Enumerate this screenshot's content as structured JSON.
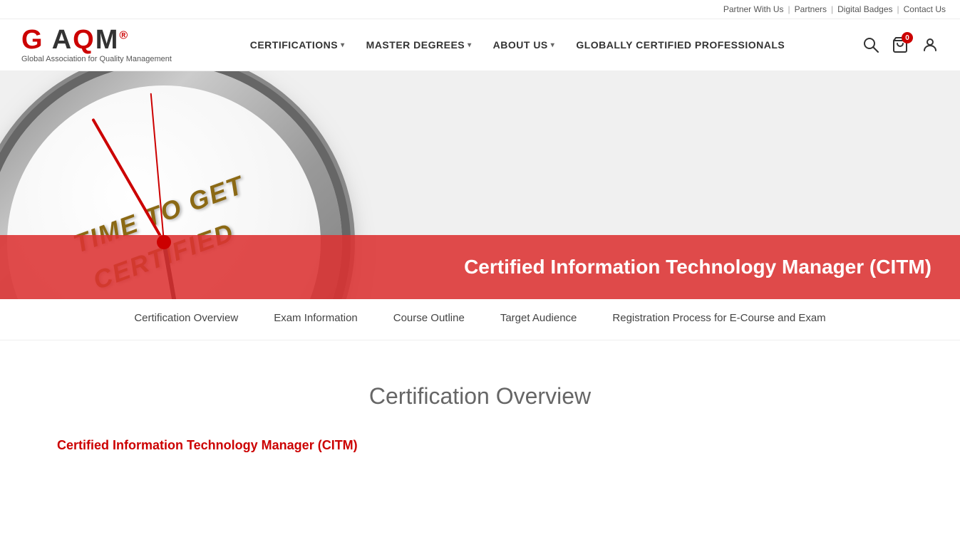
{
  "topbar": {
    "links": [
      {
        "label": "Partner With Us",
        "name": "partner-with-us-link"
      },
      {
        "label": "Partners",
        "name": "partners-link"
      },
      {
        "label": "Digital Badges",
        "name": "digital-badges-link"
      },
      {
        "label": "Contact Us",
        "name": "contact-us-link"
      }
    ]
  },
  "logo": {
    "text": "GAQM",
    "subtitle": "Global Association for Quality Management",
    "registered_symbol": "®"
  },
  "nav": {
    "items": [
      {
        "label": "CERTIFICATIONS",
        "has_dropdown": true,
        "name": "nav-certifications"
      },
      {
        "label": "MASTER DEGREES",
        "has_dropdown": true,
        "name": "nav-master-degrees"
      },
      {
        "label": "ABOUT US",
        "has_dropdown": true,
        "name": "nav-about-us"
      },
      {
        "label": "GLOBALLY CERTIFIED PROFESSIONALS",
        "has_dropdown": false,
        "name": "nav-globally-certified"
      }
    ]
  },
  "cart": {
    "count": "0"
  },
  "hero": {
    "title": "Certified Information Technology Manager (CITM)"
  },
  "sub_nav": {
    "items": [
      {
        "label": "Certification Overview",
        "name": "subnav-certification-overview",
        "active": false
      },
      {
        "label": "Exam Information",
        "name": "subnav-exam-information",
        "active": false
      },
      {
        "label": "Course Outline",
        "name": "subnav-course-outline",
        "active": false
      },
      {
        "label": "Target Audience",
        "name": "subnav-target-audience",
        "active": false
      },
      {
        "label": "Registration Process for E-Course and Exam",
        "name": "subnav-registration-process",
        "active": false
      }
    ]
  },
  "main": {
    "section_title": "Certification Overview",
    "cert_title": "Certified Information Technology Manager (CITM)"
  }
}
